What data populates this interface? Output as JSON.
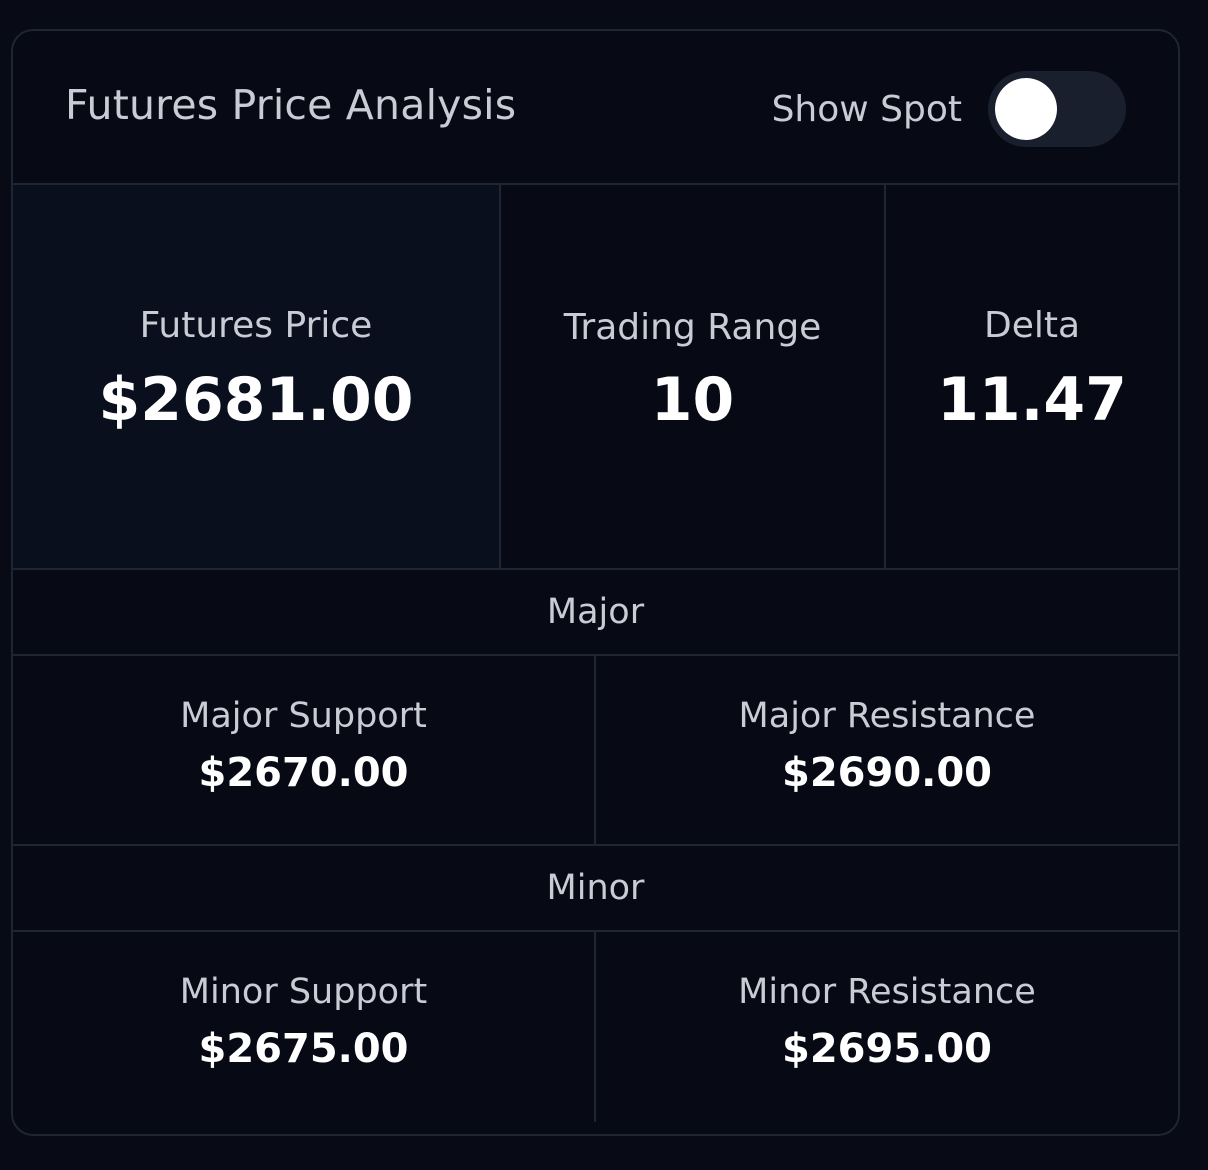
{
  "header": {
    "title": "Futures Price Analysis",
    "toggle_label": "Show Spot",
    "toggle_on": false
  },
  "stats": {
    "futures_price": {
      "label": "Futures Price",
      "value": "$2681.00"
    },
    "trading_range": {
      "label": "Trading Range",
      "value": "10"
    },
    "delta": {
      "label": "Delta",
      "value": "11.47"
    }
  },
  "major": {
    "heading": "Major",
    "support": {
      "label": "Major Support",
      "value": "$2670.00"
    },
    "resistance": {
      "label": "Major Resistance",
      "value": "$2690.00"
    }
  },
  "minor": {
    "heading": "Minor",
    "support": {
      "label": "Minor Support",
      "value": "$2675.00"
    },
    "resistance": {
      "label": "Minor Resistance",
      "value": "$2695.00"
    }
  },
  "colors": {
    "background": "#080b16",
    "card": "#070a15",
    "price_panel": "#0a0f1e",
    "border": "#1f2533",
    "text_muted": "#c9ccd4",
    "text_strong": "#ffffff"
  }
}
